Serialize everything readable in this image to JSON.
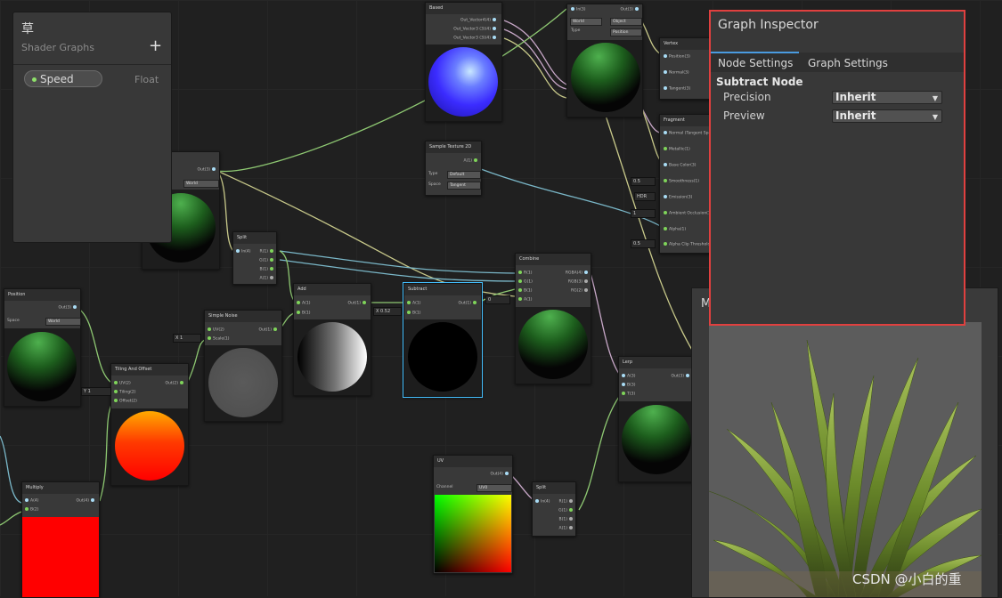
{
  "blackboard": {
    "title": "草",
    "subtitle": "Shader Graphs",
    "add_icon": "+",
    "property": {
      "name": "Speed",
      "type": "Float"
    }
  },
  "inspector": {
    "title": "Graph Inspector",
    "tabs": [
      "Node Settings",
      "Graph Settings"
    ],
    "section": "Subtract Node",
    "precision_label": "Precision",
    "precision_value": "Inherit",
    "preview_label": "Preview",
    "preview_value": "Inherit"
  },
  "main_preview": {
    "title": "M"
  },
  "watermark": "CSDN @小白的重",
  "nodes": {
    "based": {
      "title": "Based",
      "ports": [
        "Out_Vector4(4)",
        "Out_Vector3 (3)(4)",
        "Out_Vector3 (3)(4)"
      ]
    },
    "transform_top": {
      "in": "In(3)",
      "out": "Out(3)",
      "dd1": "World",
      "dd2": "Object",
      "type_label": "Type",
      "type_value": "Position"
    },
    "vertex": {
      "title": "Vertex",
      "ports": [
        "Position(3)",
        "Normal(3)",
        "Tangent(3)"
      ]
    },
    "fragment": {
      "title": "Fragment",
      "ports": [
        "Normal (Tangent Space)(3)",
        "Metallic(1)",
        "Base Color(3)",
        "Smoothness(1)",
        "Emission(3)",
        "Ambient Occlusion(1)",
        "Alpha(1)",
        "Alpha Clip Threshold(1)"
      ],
      "fields": [
        "0.5",
        "HDR",
        "1",
        "0.5"
      ]
    },
    "sample_texture": {
      "title": "Sample Texture 2D",
      "out": "A(1)",
      "type_label": "Type",
      "type_value": "Default",
      "space_label": "Space",
      "space_value": "Tangent"
    },
    "transform_left": {
      "out": "Out(3)",
      "dd": "World"
    },
    "split_top": {
      "title": "Split",
      "in": "In(4)",
      "outs": [
        "R(1)",
        "G(1)",
        "B(1)",
        "A(1)"
      ]
    },
    "position": {
      "title": "Position",
      "out": "Out(3)",
      "space_label": "Space",
      "space_value": "World"
    },
    "add": {
      "title": "Add",
      "a": "A(1)",
      "b": "B(1)",
      "out": "Out(1)"
    },
    "subtract": {
      "title": "Subtract",
      "a": "A(1)",
      "b": "B(1)",
      "out": "Out(1)",
      "x_label": "X",
      "x_value": "0.52"
    },
    "combine": {
      "title": "Combine",
      "ins": [
        "R(1)",
        "G(1)",
        "B(1)",
        "A(1)"
      ],
      "outs": [
        "RGBA(4)",
        "RGB(3)",
        "RG(2)"
      ],
      "field": "0"
    },
    "simple_noise": {
      "title": "Simple Noise",
      "uv": "UV(2)",
      "scale": "Scale(1)",
      "out": "Out(1)",
      "x_label": "X",
      "x_value": "1"
    },
    "tiling": {
      "title": "Tiling And Offset",
      "ins": [
        "UV(2)",
        "Tiling(2)",
        "Offset(2)"
      ],
      "out": "Out(2)",
      "field_label": "Y",
      "field_value": "1"
    },
    "lerp": {
      "title": "Lerp",
      "ins": [
        "A(3)",
        "B(3)",
        "T(3)"
      ],
      "out": "Out(3)"
    },
    "multiply": {
      "title": "Multiply",
      "ins": [
        "A(4)",
        "B(2)"
      ],
      "out": "Out(4)"
    },
    "uv": {
      "title": "UV",
      "out": "Out(4)",
      "channel_label": "Channel",
      "channel_value": "UV0"
    },
    "split_bottom": {
      "title": "Split",
      "in": "In(4)",
      "outs": [
        "R(1)",
        "G(1)",
        "B(1)",
        "A(1)"
      ]
    }
  },
  "colors": {
    "highlight": "#e0403f",
    "tab_underline": "#4a9be0",
    "float_port": "#8ee06a",
    "vector_port": "#a9dcf5"
  }
}
